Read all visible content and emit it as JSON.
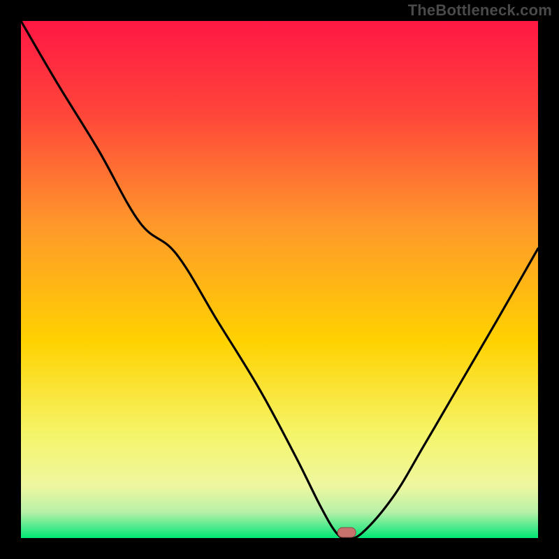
{
  "watermark": "TheBottleneck.com",
  "colors": {
    "background_black": "#000000",
    "gradient_top": "#ff1744",
    "gradient_mid_upper": "#ff6d2e",
    "gradient_mid": "#ffd200",
    "gradient_mid_lower": "#f7f77a",
    "gradient_bottom": "#00e676",
    "curve": "#000000",
    "marker_fill": "#c7726c",
    "marker_stroke": "#8a4a45"
  },
  "chart_data": {
    "type": "line",
    "title": "",
    "xlabel": "",
    "ylabel": "",
    "xlim": [
      0,
      100
    ],
    "ylim": [
      0,
      100
    ],
    "series": [
      {
        "name": "bottleneck-curve",
        "x": [
          0,
          7,
          15,
          23,
          30,
          38,
          46,
          53,
          58,
          61,
          63,
          66,
          72,
          78,
          85,
          92,
          100
        ],
        "y": [
          100,
          88,
          75,
          61,
          55,
          42,
          29,
          16,
          6,
          1,
          0,
          1,
          8,
          18,
          30,
          42,
          56
        ]
      }
    ],
    "annotations": [
      {
        "name": "optimal-marker",
        "x": 63,
        "y": 0
      }
    ],
    "grid": false,
    "legend": false
  }
}
